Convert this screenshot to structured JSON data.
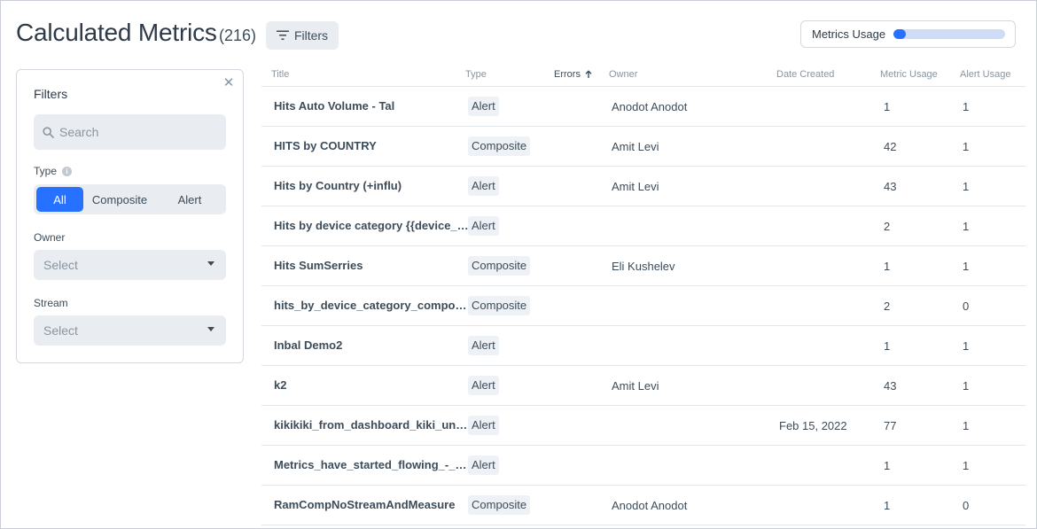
{
  "header": {
    "title": "Calculated Metrics",
    "count": "(216)",
    "filters_button": "Filters",
    "usage_label": "Metrics Usage",
    "usage_fraction": 0.11,
    "accent_color": "#2671ff"
  },
  "filters": {
    "title": "Filters",
    "close_icon": "close-icon",
    "search_placeholder": "Search",
    "type_label": "Type",
    "type_options": [
      "All",
      "Composite",
      "Alert"
    ],
    "type_selected": "All",
    "owner_label": "Owner",
    "owner_value": "Select",
    "stream_label": "Stream",
    "stream_value": "Select"
  },
  "table": {
    "columns": {
      "title": "Title",
      "type": "Type",
      "errors": "Errors",
      "owner": "Owner",
      "date_created": "Date Created",
      "metric_usage": "Metric Usage",
      "alert_usage": "Alert Usage"
    },
    "sorted_by": "errors",
    "rows": [
      {
        "title": "Hits Auto Volume - Tal",
        "type": "Alert",
        "owner": "Anodot Anodot",
        "date": "",
        "metric_usage": "1",
        "alert_usage": "1"
      },
      {
        "title": "HITS by COUNTRY",
        "type": "Composite",
        "owner": "Amit Levi",
        "date": "",
        "metric_usage": "42",
        "alert_usage": "1"
      },
      {
        "title": "Hits by Country (+influ)",
        "type": "Alert",
        "owner": "Amit Levi",
        "date": "",
        "metric_usage": "43",
        "alert_usage": "1"
      },
      {
        "title": "Hits by device category {{device_cate…",
        "type": "Alert",
        "owner": "",
        "date": "",
        "metric_usage": "2",
        "alert_usage": "1"
      },
      {
        "title": "Hits SumSerries",
        "type": "Composite",
        "owner": "Eli Kushelev",
        "date": "",
        "metric_usage": "1",
        "alert_usage": "1"
      },
      {
        "title": "hits_by_device_category_composite",
        "type": "Composite",
        "owner": "",
        "date": "",
        "metric_usage": "2",
        "alert_usage": "0"
      },
      {
        "title": "Inbal Demo2",
        "type": "Alert",
        "owner": "",
        "date": "",
        "metric_usage": "1",
        "alert_usage": "1"
      },
      {
        "title": "k2",
        "type": "Alert",
        "owner": "Amit Levi",
        "date": "",
        "metric_usage": "43",
        "alert_usage": "1"
      },
      {
        "title": "kikikiki_from_dashboard_kiki_undefi…",
        "type": "Alert",
        "owner": "",
        "date": "Feb 15, 2022",
        "metric_usage": "77",
        "alert_usage": "1"
      },
      {
        "title": "Metrics_have_started_flowing_-_che…",
        "type": "Alert",
        "owner": "",
        "date": "",
        "metric_usage": "1",
        "alert_usage": "1"
      },
      {
        "title": "RamCompNoStreamAndMeasure",
        "type": "Composite",
        "owner": "Anodot Anodot",
        "date": "",
        "metric_usage": "1",
        "alert_usage": "0"
      }
    ]
  }
}
